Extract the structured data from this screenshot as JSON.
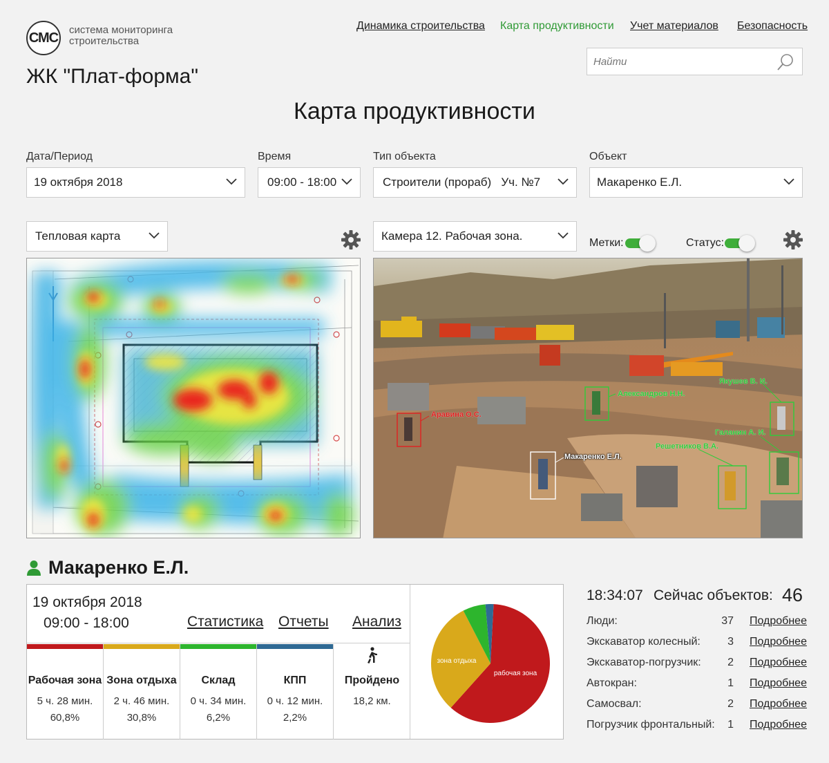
{
  "logo": {
    "abbr": "СМС",
    "text": "система мониторинга строительства"
  },
  "nav": [
    {
      "label": "Динамика строительства",
      "active": false
    },
    {
      "label": "Карта продуктивности",
      "active": true
    },
    {
      "label": "Учет материалов",
      "active": false
    },
    {
      "label": "Безопасность",
      "active": false
    }
  ],
  "project_title": "ЖК \"Плат-форма\"",
  "search": {
    "placeholder": "Найти",
    "icon": "search-icon"
  },
  "page_title": "Карта продуктивности",
  "filters": {
    "date": {
      "label": "Дата/Период",
      "value": "19 октября 2018"
    },
    "time": {
      "label": "Время",
      "value": "09:00 - 18:00"
    },
    "object_type": {
      "label": "Тип объекта",
      "value": "Строители (прораб)   Уч. №7"
    },
    "object": {
      "label": "Объект",
      "value": "Макаренко Е.Л."
    }
  },
  "map_view": {
    "value": "Тепловая карта"
  },
  "camera": {
    "value": "Камера 12. Рабочая зона."
  },
  "toggles": {
    "labels": {
      "label": "Метки:",
      "on": true
    },
    "status": {
      "label": "Статус:",
      "on": true
    }
  },
  "camera_tags": [
    {
      "name": "Александров Н.Н.",
      "color": "#2ecc3a"
    },
    {
      "name": "Якушев В. И.",
      "color": "#2ecc3a"
    },
    {
      "name": "Аравина О.С.",
      "color": "#e02020"
    },
    {
      "name": "Галанин А. И.",
      "color": "#2ecc3a"
    },
    {
      "name": "Решетников В.А.",
      "color": "#2ecc3a"
    },
    {
      "name": "Макаренко Е.Л.",
      "color": "#ffffff"
    }
  ],
  "person": {
    "name": "Макаренко Е.Л.",
    "icon": "user-icon"
  },
  "card": {
    "date": "19 октября 2018",
    "time": "09:00 - 18:00",
    "links": [
      "Статистика",
      "Отчеты",
      "Анализ"
    ],
    "zones": [
      {
        "name": "Рабочая зона",
        "duration": "5 ч. 28 мин.",
        "percent": "60,8%",
        "color": "#c0191c"
      },
      {
        "name": "Зона отдыха",
        "duration": "2 ч. 46 мин.",
        "percent": "30,8%",
        "color": "#d9a91b"
      },
      {
        "name": "Склад",
        "duration": "0 ч. 34 мин.",
        "percent": "6,2%",
        "color": "#2db52d"
      },
      {
        "name": "КПП",
        "duration": "0 ч. 12 мин.",
        "percent": "2,2%",
        "color": "#2f6a94"
      }
    ],
    "walked": {
      "label": "Пройдено",
      "value": "18,2 км.",
      "icon": "walking-person-icon"
    }
  },
  "chart_data": {
    "type": "pie",
    "slices": [
      {
        "label": "рабочая зона",
        "value": 60.8,
        "color": "#c0191c"
      },
      {
        "label": "зона отдыха",
        "value": 30.8,
        "color": "#d9a91b"
      },
      {
        "label": "",
        "value": 6.2,
        "color": "#2db52d"
      },
      {
        "label": "",
        "value": 2.2,
        "color": "#2f6a94"
      }
    ]
  },
  "now": {
    "time": "18:34:07",
    "label": "Сейчас объектов:",
    "count": "46",
    "more_label": "Подробнее",
    "rows": [
      {
        "label": "Люди:",
        "value": "37"
      },
      {
        "label": "Экскаватор колесный:",
        "value": "3"
      },
      {
        "label": "Экскаватор-погрузчик:",
        "value": "2"
      },
      {
        "label": "Автокран:",
        "value": "1"
      },
      {
        "label": "Самосвал:",
        "value": "2"
      },
      {
        "label": "Погрузчик фронтальный:",
        "value": "1"
      }
    ]
  }
}
